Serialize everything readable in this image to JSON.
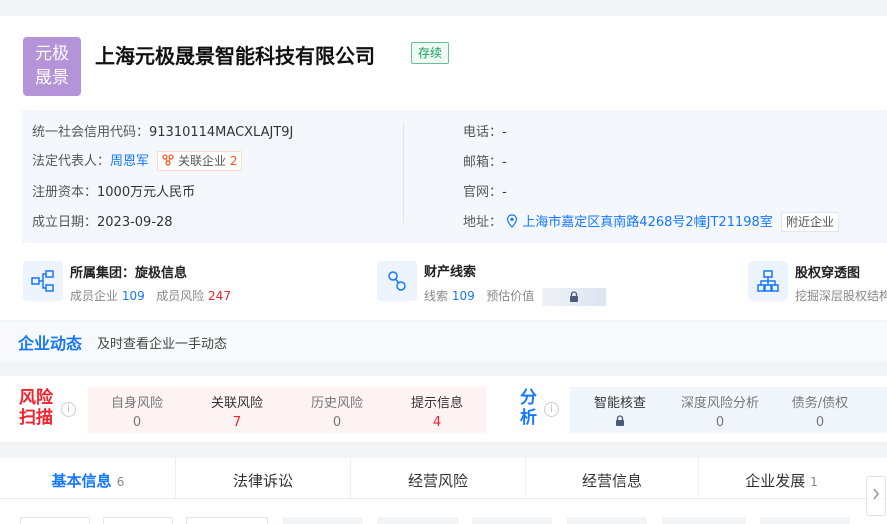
{
  "company": {
    "logo_text_line1": "元极",
    "logo_text_line2": "晟景",
    "name": "上海元极晟景智能科技有限公司",
    "status": "存续"
  },
  "info": {
    "credit_code_label": "统一社会信用代码：",
    "credit_code": "91310114MACXLAJT9J",
    "legal_rep_label": "法定代表人：",
    "legal_rep": "周恩军",
    "related_label": "关联企业",
    "related_count": "2",
    "capital_label": "注册资本：",
    "capital": "1000万元人民币",
    "founded_label": "成立日期：",
    "founded": "2023-09-28",
    "phone_label": "电话：",
    "phone": "-",
    "email_label": "邮箱：",
    "email": "-",
    "website_label": "官网：",
    "website": "-",
    "address_label": "地址：",
    "address": "上海市嘉定区真南路4268号2幢JT21198室",
    "nearby_label": "附近企业"
  },
  "features": {
    "group_title": "所属集团：旋极信息",
    "group_members_label": "成员企业",
    "group_members": "109",
    "group_risk_label": "成员风险",
    "group_risk": "247",
    "property_title": "财产线索",
    "property_clues_label": "线索",
    "property_clues": "109",
    "property_value_label": "预估价值",
    "equity_title": "股权穿透图",
    "equity_sub": "挖掘深层股权结构"
  },
  "dynamics": {
    "title": "企业动态",
    "subtitle": "及时查看企业一手动态"
  },
  "risk": {
    "title_line1": "风险",
    "title_line2": "扫描",
    "items": [
      {
        "label": "自身风险",
        "value": "0"
      },
      {
        "label": "关联风险",
        "value": "7"
      },
      {
        "label": "历史风险",
        "value": "0"
      },
      {
        "label": "提示信息",
        "value": "4"
      }
    ]
  },
  "analysis": {
    "title_line1": "分",
    "title_line2": "析",
    "items": [
      {
        "label": "智能核查",
        "value": ""
      },
      {
        "label": "深度风险分析",
        "value": "0"
      },
      {
        "label": "债务/债权",
        "value": "0"
      }
    ]
  },
  "tabs": [
    {
      "label": "基本信息",
      "count": "6"
    },
    {
      "label": "法律诉讼",
      "count": ""
    },
    {
      "label": "经营风险",
      "count": ""
    },
    {
      "label": "经营信息",
      "count": ""
    },
    {
      "label": "企业发展",
      "count": "1"
    }
  ],
  "colors": {
    "accent": "#1677ff",
    "risk_red": "#f5222d",
    "status_green": "#16a05e",
    "logo_bg": "#b493d8"
  }
}
